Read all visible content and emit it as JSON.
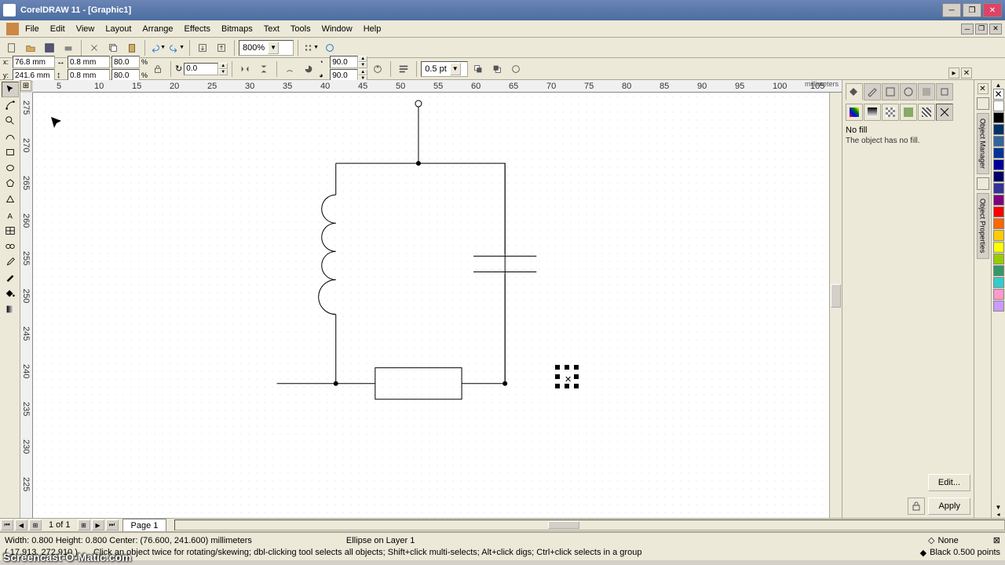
{
  "title": "CorelDRAW 11 - [Graphic1]",
  "menu": [
    "File",
    "Edit",
    "View",
    "Layout",
    "Arrange",
    "Effects",
    "Bitmaps",
    "Text",
    "Tools",
    "Window",
    "Help"
  ],
  "zoom": "800%",
  "obj_x": "76.8 mm",
  "obj_y": "241.6 mm",
  "obj_w": "0.8 mm",
  "obj_h": "0.8 mm",
  "scale_x": "80.0",
  "scale_y": "80.0",
  "rotation": "0.0",
  "skew1": "90.0",
  "skew2": "90.0",
  "outline_width": "0.5 pt",
  "ruler_unit": "millimeters",
  "hruler_ticks": [
    "5",
    "10",
    "15",
    "20",
    "25",
    "30",
    "35",
    "40",
    "45",
    "50",
    "55",
    "60",
    "65",
    "70",
    "75",
    "80",
    "85",
    "90",
    "95",
    "100",
    "105"
  ],
  "vruler_ticks": [
    "275",
    "270",
    "265",
    "260",
    "255",
    "250",
    "245",
    "240",
    "235",
    "230",
    "225"
  ],
  "page_count": "1 of 1",
  "page_tab": "Page 1",
  "docker": {
    "nofill_title": "No fill",
    "nofill_desc": "The object has no fill.",
    "edit_btn": "Edit...",
    "apply_btn": "Apply",
    "right_tabs": [
      "Object Manager",
      "Object Properties"
    ]
  },
  "palette": [
    "#ffffff",
    "#000000",
    "#003366",
    "#336699",
    "#003399",
    "#000099",
    "#000066",
    "#333399",
    "#800080",
    "#ff0000",
    "#ff6600",
    "#ffcc00",
    "#ffff00",
    "#99cc00",
    "#339966",
    "#33cccc",
    "#ff99cc",
    "#cc99ff"
  ],
  "status": {
    "line1_dims": "Width: 0.800   Height: 0.800   Center: (76.600, 241.600)   millimeters",
    "line1_obj": "Ellipse on Layer 1",
    "line2_coords": "( 17.913, 272.910 )",
    "line2_hint": "Click an object twice for rotating/skewing; dbl-clicking tool selects all objects; Shift+click multi-selects; Alt+click digs; Ctrl+click selects in a group",
    "fill_label": "None",
    "outline_label": "Black  0.500 points"
  },
  "watermark": "Screencast-O-Matic.com"
}
